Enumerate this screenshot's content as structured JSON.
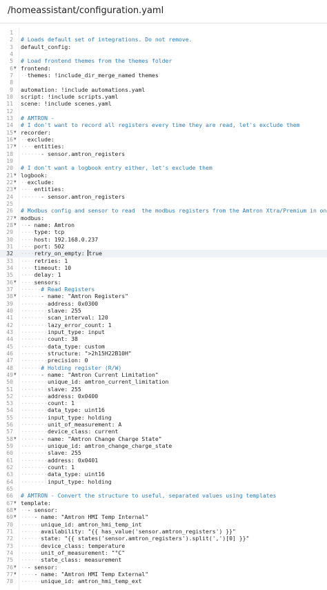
{
  "header": {
    "file_path": "/homeassistant/configuration.yaml"
  },
  "editor": {
    "active_line": 32,
    "lines": [
      {
        "n": "1",
        "f": false,
        "ind": 0,
        "t": ""
      },
      {
        "n": "2",
        "f": false,
        "ind": 0,
        "t": "# Loads default set of integrations. Do not remove.",
        "c": true
      },
      {
        "n": "3",
        "f": false,
        "ind": 0,
        "t": "default_config:"
      },
      {
        "n": "4",
        "f": false,
        "ind": 0,
        "t": ""
      },
      {
        "n": "5",
        "f": false,
        "ind": 0,
        "t": "# Load frontend themes from the themes folder",
        "c": true
      },
      {
        "n": "6",
        "f": true,
        "ind": 0,
        "t": "frontend:"
      },
      {
        "n": "7",
        "f": false,
        "ind": 1,
        "t": "themes: !include_dir_merge_named themes"
      },
      {
        "n": "8",
        "f": false,
        "ind": 0,
        "t": ""
      },
      {
        "n": "9",
        "f": false,
        "ind": 0,
        "t": "automation: !include automations.yaml"
      },
      {
        "n": "10",
        "f": false,
        "ind": 0,
        "t": "script: !include scripts.yaml"
      },
      {
        "n": "11",
        "f": false,
        "ind": 0,
        "t": "scene: !include scenes.yaml"
      },
      {
        "n": "12",
        "f": false,
        "ind": 0,
        "t": ""
      },
      {
        "n": "13",
        "f": false,
        "ind": 0,
        "t": "# AMTRON -",
        "c": true
      },
      {
        "n": "14",
        "f": false,
        "ind": 0,
        "t": "# I don't want to record all registers every time they are read, let's exclude them",
        "c": true
      },
      {
        "n": "15",
        "f": true,
        "ind": 0,
        "t": "recorder:"
      },
      {
        "n": "16",
        "f": true,
        "ind": 1,
        "t": "exclude:"
      },
      {
        "n": "17",
        "f": true,
        "ind": 2,
        "t": "entities:"
      },
      {
        "n": "18",
        "f": false,
        "ind": 3,
        "t": "- sensor.amtron_registers"
      },
      {
        "n": "19",
        "f": false,
        "ind": 0,
        "t": ""
      },
      {
        "n": "20",
        "f": false,
        "ind": 0,
        "t": "# I don't want a logbook entry either, let's exclude them",
        "c": true
      },
      {
        "n": "21",
        "f": true,
        "ind": 0,
        "t": "logbook:"
      },
      {
        "n": "22",
        "f": true,
        "ind": 1,
        "t": "exclude:"
      },
      {
        "n": "23",
        "f": true,
        "ind": 2,
        "t": "entities:"
      },
      {
        "n": "24",
        "f": false,
        "ind": 3,
        "t": "- sensor.amtron_registers"
      },
      {
        "n": "25",
        "f": false,
        "ind": 0,
        "t": ""
      },
      {
        "n": "26",
        "f": false,
        "ind": 0,
        "t": "# Modbus config and sensor to read  the modbus registers from the Amtron Xtra/Premium in one go",
        "c": true
      },
      {
        "n": "27",
        "f": true,
        "ind": 0,
        "t": "modbus:"
      },
      {
        "n": "28",
        "f": true,
        "ind": 1,
        "t": "- name: Amtron"
      },
      {
        "n": "29",
        "f": false,
        "ind": 2,
        "t": "type: tcp"
      },
      {
        "n": "30",
        "f": false,
        "ind": 2,
        "t": "host: 192.168.0.237"
      },
      {
        "n": "31",
        "f": false,
        "ind": 2,
        "t": "port: 502"
      },
      {
        "n": "32",
        "f": false,
        "ind": 2,
        "t": "retry_on_empty: ",
        "tail": "true"
      },
      {
        "n": "33",
        "f": false,
        "ind": 2,
        "t": "retries: 1"
      },
      {
        "n": "34",
        "f": false,
        "ind": 2,
        "t": "timeout: 10"
      },
      {
        "n": "35",
        "f": false,
        "ind": 2,
        "t": "delay: 1"
      },
      {
        "n": "36",
        "f": true,
        "ind": 2,
        "t": "sensors:"
      },
      {
        "n": "37",
        "f": false,
        "ind": 3,
        "t": "# Read Registers",
        "c": true
      },
      {
        "n": "38",
        "f": true,
        "ind": 3,
        "t": "- name: \"Amtron Registers\""
      },
      {
        "n": "39",
        "f": false,
        "ind": 4,
        "t": "address: 0x0300"
      },
      {
        "n": "40",
        "f": false,
        "ind": 4,
        "t": "slave: 255"
      },
      {
        "n": "41",
        "f": false,
        "ind": 4,
        "t": "scan_interval: 120"
      },
      {
        "n": "42",
        "f": false,
        "ind": 4,
        "t": "lazy_error_count: 1"
      },
      {
        "n": "43",
        "f": false,
        "ind": 4,
        "t": "input_type: input"
      },
      {
        "n": "44",
        "f": false,
        "ind": 4,
        "t": "count: 38"
      },
      {
        "n": "45",
        "f": false,
        "ind": 4,
        "t": "data_type: custom"
      },
      {
        "n": "46",
        "f": false,
        "ind": 4,
        "t": "structure: \">2h15H22B10H\""
      },
      {
        "n": "47",
        "f": false,
        "ind": 4,
        "t": "precision: 0"
      },
      {
        "n": "48",
        "f": false,
        "ind": 3,
        "t": "# Holding register (R/W)",
        "c": true
      },
      {
        "n": "49",
        "f": true,
        "ind": 3,
        "t": "- name: \"Amtron Current Limitation\""
      },
      {
        "n": "50",
        "f": false,
        "ind": 4,
        "t": "unique_id: amtron_current_limitation"
      },
      {
        "n": "51",
        "f": false,
        "ind": 4,
        "t": "slave: 255"
      },
      {
        "n": "52",
        "f": false,
        "ind": 4,
        "t": "address: 0x0400"
      },
      {
        "n": "53",
        "f": false,
        "ind": 4,
        "t": "count: 1"
      },
      {
        "n": "54",
        "f": false,
        "ind": 4,
        "t": "data_type: uint16"
      },
      {
        "n": "55",
        "f": false,
        "ind": 4,
        "t": "input_type: holding"
      },
      {
        "n": "56",
        "f": false,
        "ind": 4,
        "t": "unit_of_measurement: A"
      },
      {
        "n": "57",
        "f": false,
        "ind": 4,
        "t": "device_class: current"
      },
      {
        "n": "58",
        "f": true,
        "ind": 3,
        "t": "- name: \"Amtron Change Charge State\""
      },
      {
        "n": "59",
        "f": false,
        "ind": 4,
        "t": "unique_id: amtron_change_charge_state"
      },
      {
        "n": "60",
        "f": false,
        "ind": 4,
        "t": "slave: 255"
      },
      {
        "n": "61",
        "f": false,
        "ind": 4,
        "t": "address: 0x0401"
      },
      {
        "n": "62",
        "f": false,
        "ind": 4,
        "t": "count: 1"
      },
      {
        "n": "63",
        "f": false,
        "ind": 4,
        "t": "data_type: uint16"
      },
      {
        "n": "64",
        "f": false,
        "ind": 4,
        "t": "input_type: holding"
      },
      {
        "n": "65",
        "f": false,
        "ind": 0,
        "t": ""
      },
      {
        "n": "66",
        "f": false,
        "ind": 0,
        "t": "# AMTRON - Convert the structure to useful, separated values using templates",
        "c": true
      },
      {
        "n": "67",
        "f": true,
        "ind": 0,
        "t": "template:"
      },
      {
        "n": "68",
        "f": true,
        "ind": 1,
        "t": "- sensor:"
      },
      {
        "n": "69",
        "f": true,
        "ind": 2,
        "t": "- name: \"Amtron HMI Temp Internal\""
      },
      {
        "n": "70",
        "f": false,
        "ind": 3,
        "t": "unique_id: amtron_hmi_temp_int"
      },
      {
        "n": "71",
        "f": false,
        "ind": 3,
        "t": "availability: \"{{ has_value('sensor.amtron_registers') }}\""
      },
      {
        "n": "72",
        "f": false,
        "ind": 3,
        "t": "state: \"{{ states('sensor.amtron_registers').split(',')[0] }}\""
      },
      {
        "n": "73",
        "f": false,
        "ind": 3,
        "t": "device_class: temperature"
      },
      {
        "n": "74",
        "f": false,
        "ind": 3,
        "t": "unit_of_measurement: \"°C\""
      },
      {
        "n": "75",
        "f": false,
        "ind": 3,
        "t": "state_class: measurement"
      },
      {
        "n": "76",
        "f": true,
        "ind": 1,
        "t": "- sensor:"
      },
      {
        "n": "77",
        "f": true,
        "ind": 2,
        "t": "- name: \"Amtron HMI Temp External\""
      },
      {
        "n": "78",
        "f": false,
        "ind": 3,
        "t": "unique_id: amtron_hmi_temp_ext"
      }
    ]
  }
}
